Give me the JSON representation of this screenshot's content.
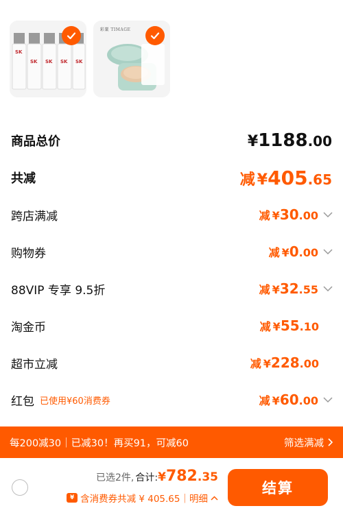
{
  "products": [
    {
      "name": "SK-II product",
      "icon": "sk2-bottles-image",
      "selected": true,
      "bottle_label": "SK-II"
    },
    {
      "name": "TIMAGE cushion",
      "icon": "cushion-compact-image",
      "selected": true,
      "brand_text": "彩棠 TIMAGE"
    }
  ],
  "rows": [
    {
      "label": "商品总价",
      "prefix": "",
      "yen": "¥",
      "int": "1188",
      "dec": ".00",
      "style": "total"
    },
    {
      "label": "共减",
      "prefix": "减",
      "yen": "¥",
      "int": "405",
      "dec": ".65",
      "style": "big"
    },
    {
      "label": "跨店满减",
      "prefix": "减",
      "yen": "¥",
      "int": "30",
      "dec": ".00",
      "chevron": true
    },
    {
      "label": "购物券",
      "prefix": "减",
      "yen": "¥",
      "int": "0",
      "dec": ".00",
      "chevron": true
    },
    {
      "label": "88VIP 专享 9.5折",
      "prefix": "减",
      "yen": "¥",
      "int": "32",
      "dec": ".55",
      "chevron": true
    },
    {
      "label": "淘金币",
      "prefix": "减",
      "yen": "¥",
      "int": "55",
      "dec": ".10",
      "chevron": false
    },
    {
      "label": "超市立减",
      "prefix": "减",
      "yen": "¥",
      "int": "228",
      "dec": ".00",
      "chevron": false
    },
    {
      "label": "红包",
      "note": "已使用¥60消费券",
      "prefix": "减",
      "yen": "¥",
      "int": "60",
      "dec": ".00",
      "chevron": true
    }
  ],
  "promo": {
    "text": "每200减30｜已减30！再买91，可减60",
    "filter_label": "筛选满减"
  },
  "bottom_bar": {
    "selected_count": "已选2件,",
    "total_label": "合计:",
    "total_yen": "¥",
    "total_int": "782",
    "total_dec": ".35",
    "coupon_icon_text": "¥",
    "discount_detail": "含消费券共减 ¥ 405.65｜明细",
    "checkout_label": "结算"
  },
  "colors": {
    "accent": "#ff5a00",
    "text": "#111111",
    "muted": "#666666"
  }
}
